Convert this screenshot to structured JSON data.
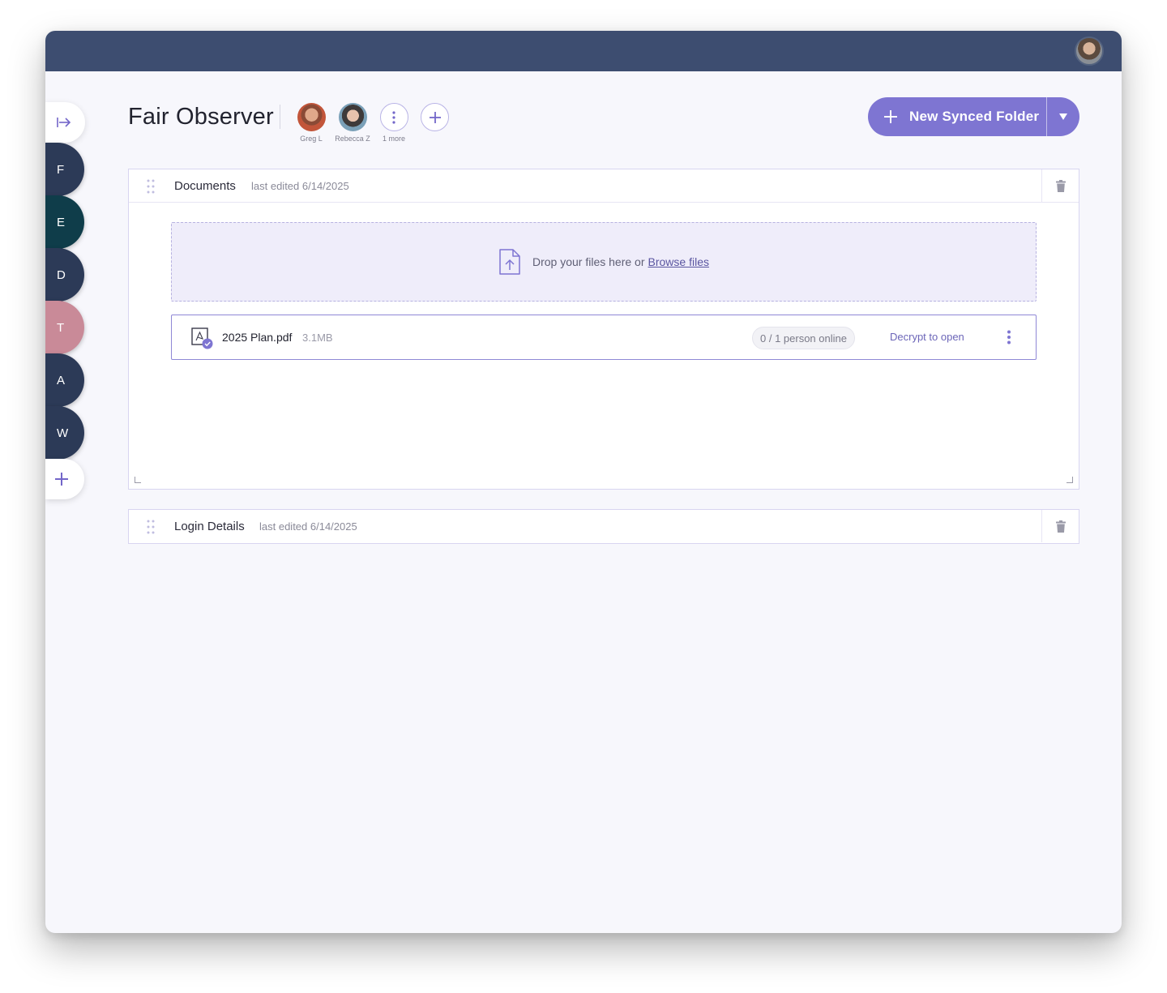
{
  "workspace": {
    "title": "Fair Observer",
    "members": [
      {
        "name": "Greg L"
      },
      {
        "name": "Rebecca Z"
      }
    ],
    "more_label": "1 more"
  },
  "rail": {
    "spaces": [
      {
        "letter": "F",
        "color": "#2c3a57"
      },
      {
        "letter": "E",
        "color": "#0f3d4a"
      },
      {
        "letter": "D",
        "color": "#2c3a57"
      },
      {
        "letter": "T",
        "color": "#c98a98"
      },
      {
        "letter": "A",
        "color": "#2c3a57"
      },
      {
        "letter": "W",
        "color": "#2c3a57"
      }
    ]
  },
  "actions": {
    "new_folder_label": "New Synced Folder"
  },
  "sections": [
    {
      "title": "Documents",
      "meta": "last edited 6/14/2025",
      "dropzone": {
        "text": "Drop your files here or",
        "link": "Browse files"
      },
      "files": [
        {
          "name": "2025 Plan.pdf",
          "size": "3.1MB",
          "online": "0 / 1 person online",
          "action": "Decrypt to open"
        }
      ]
    },
    {
      "title": "Login Details",
      "meta": "last edited 6/14/2025"
    }
  ],
  "colors": {
    "topbar": "#3d4d70",
    "accent": "#7e75d2",
    "background": "#f7f7fc"
  }
}
